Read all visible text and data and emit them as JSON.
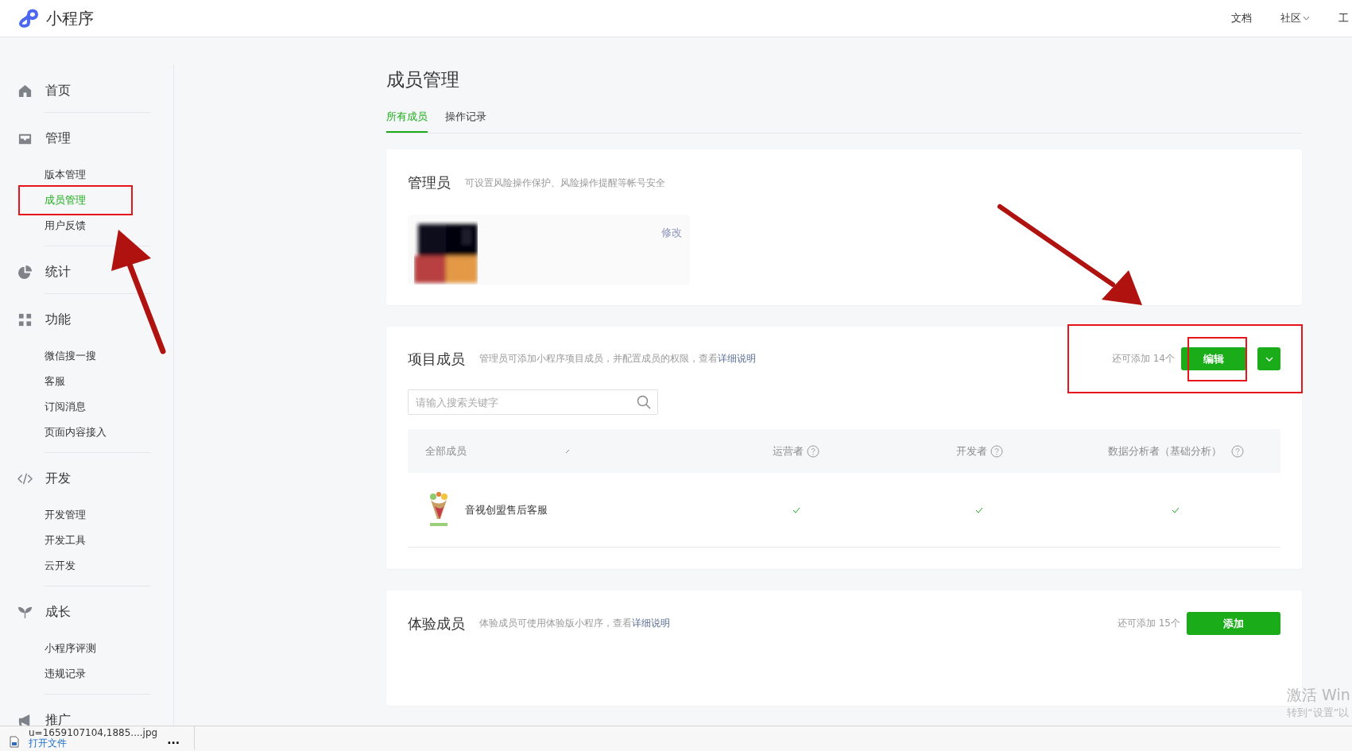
{
  "topbar": {
    "brand": "小程序",
    "links": [
      {
        "label": "文档",
        "dropdown": false
      },
      {
        "label": "社区",
        "dropdown": true
      },
      {
        "label": "工",
        "dropdown": false
      }
    ]
  },
  "sidebar": {
    "groups": [
      {
        "kind": "home",
        "label": "首页"
      },
      {
        "kind": "inbox",
        "label": "管理",
        "items": [
          {
            "label": "版本管理",
            "selected": false
          },
          {
            "label": "成员管理",
            "selected": true
          },
          {
            "label": "用户反馈",
            "selected": false
          }
        ]
      },
      {
        "kind": "pie",
        "label": "统计"
      },
      {
        "kind": "grid",
        "label": "功能",
        "items": [
          {
            "label": "微信搜一搜",
            "selected": false
          },
          {
            "label": "客服",
            "selected": false
          },
          {
            "label": "订阅消息",
            "selected": false
          },
          {
            "label": "页面内容接入",
            "selected": false
          }
        ]
      },
      {
        "kind": "code",
        "label": "开发",
        "items": [
          {
            "label": "开发管理",
            "selected": false
          },
          {
            "label": "开发工具",
            "selected": false
          },
          {
            "label": "云开发",
            "selected": false
          }
        ]
      },
      {
        "kind": "sprout",
        "label": "成长",
        "items": [
          {
            "label": "小程序评测",
            "selected": false
          },
          {
            "label": "违规记录",
            "selected": false
          }
        ]
      },
      {
        "kind": "megaphone",
        "label": "推广"
      }
    ]
  },
  "page": {
    "title": "成员管理",
    "tabs": [
      {
        "label": "所有成员",
        "selected": true
      },
      {
        "label": "操作记录",
        "selected": false
      }
    ]
  },
  "admin": {
    "title": "管理员",
    "hint": "可设置风险操作保护、风险操作提醒等帐号安全",
    "edit_link": "修改"
  },
  "project": {
    "title": "项目成员",
    "hint": "管理员可添加小程序项目成员，并配置成员的权限，查看",
    "hint_link": "详细说明",
    "remaining": "还可添加 14个",
    "edit_button": "编辑",
    "search": {
      "placeholder": "请输入搜索关键字"
    },
    "columns": [
      "全部成员",
      "运营者",
      "开发者",
      "数据分析者（基础分析）"
    ],
    "members": [
      {
        "name": "音视创盟售后客服",
        "roles": [
          {
            "checked": true
          },
          {
            "checked": true
          },
          {
            "checked": true
          }
        ]
      }
    ]
  },
  "trial": {
    "title": "体验成员",
    "hint": "体验成员可使用体验版小程序，查看",
    "hint_link": "详细说明",
    "remaining": "还可添加 15个",
    "add_button": "添加"
  },
  "download": {
    "file": "u=1659107104,1885....jpg",
    "action": "打开文件",
    "more": "..."
  },
  "os_notice": {
    "title": "激活 Win",
    "subtitle": "转到“设置”以"
  }
}
